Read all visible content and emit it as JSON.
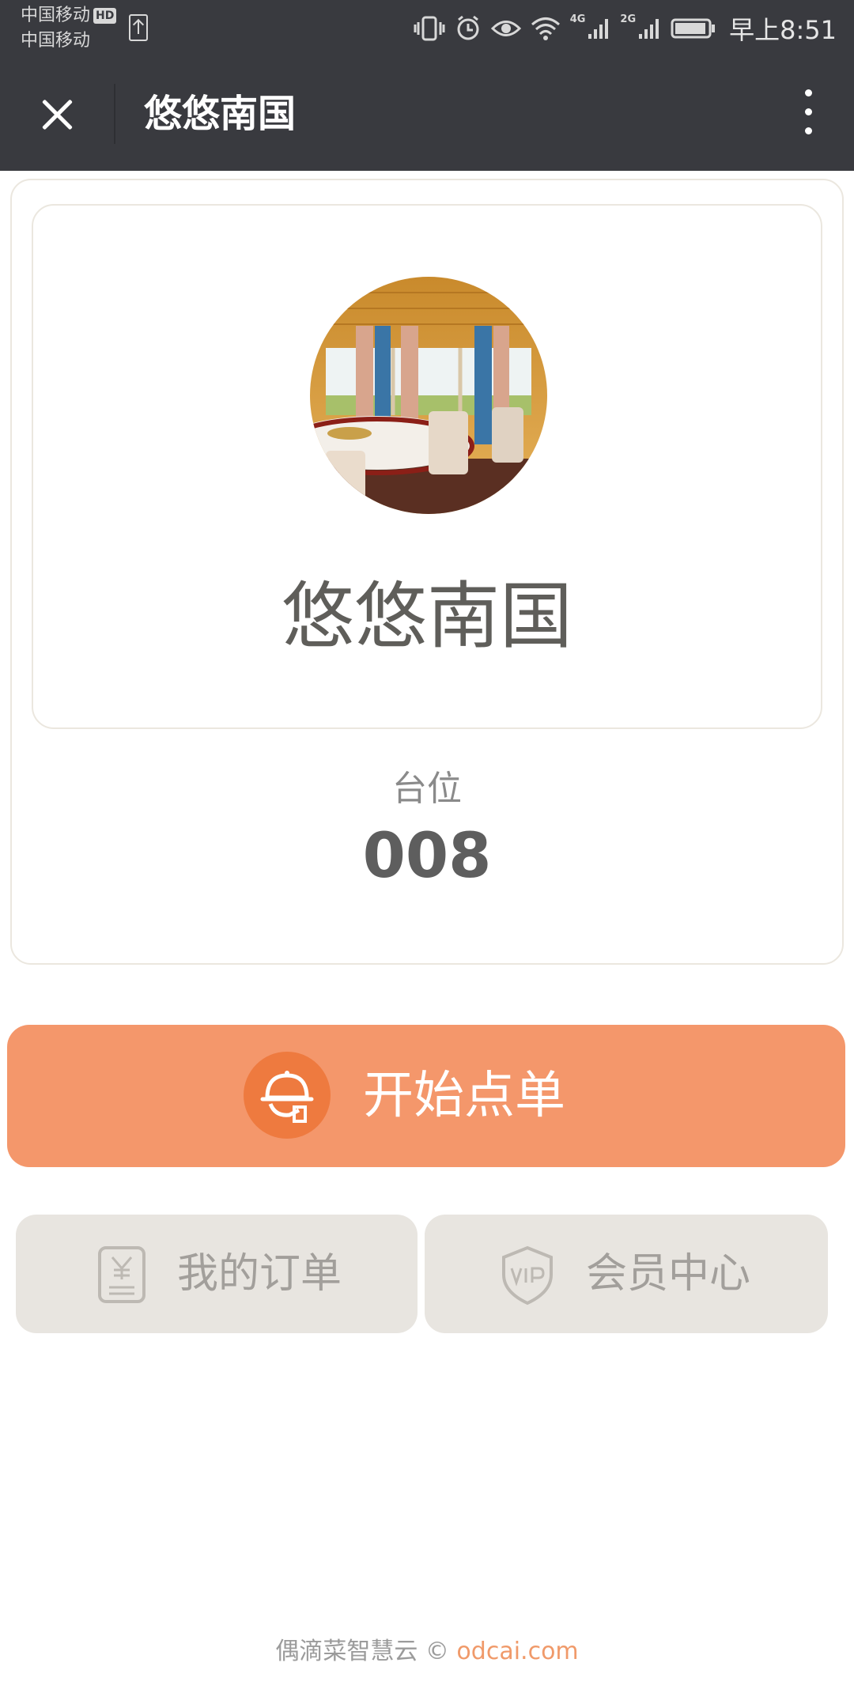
{
  "status_bar": {
    "carrier_1": "中国移动",
    "carrier_1_badge": "HD",
    "carrier_2": "中国移动",
    "network_1": "4G",
    "network_2": "2G",
    "time": "早上8:51"
  },
  "titlebar": {
    "title": "悠悠南国"
  },
  "store": {
    "name": "悠悠南国",
    "table_label": "台位",
    "table_number": "008"
  },
  "actions": {
    "start_order": "开始点单",
    "my_orders": "我的订单",
    "member_center": "会员中心"
  },
  "footer": {
    "text": "偶滴菜智慧云 © ",
    "link": "odcai.com"
  },
  "colors": {
    "bar_background": "#393a3f",
    "primary": "#f4976b",
    "primary_icon_bg": "#ee7a3f",
    "secondary_button": "#e8e5e0",
    "link": "#f09a6a"
  }
}
